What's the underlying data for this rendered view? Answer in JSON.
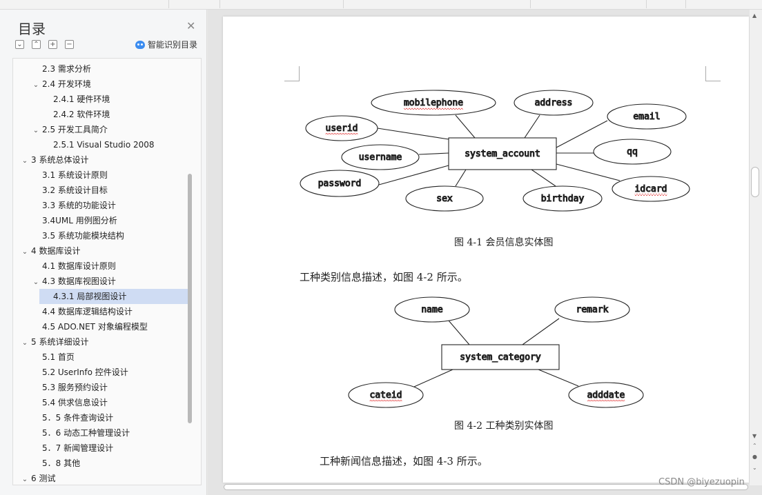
{
  "toc": {
    "title": "目录",
    "smart_label": "智能识别目录",
    "items": [
      {
        "label": "2.3  需求分析",
        "level": 1,
        "expand": ""
      },
      {
        "label": "2.4  开发环境",
        "level": 1,
        "expand": "open"
      },
      {
        "label": "2.4.1 硬件环境",
        "level": 2,
        "expand": ""
      },
      {
        "label": "2.4.2 软件环境",
        "level": 2,
        "expand": ""
      },
      {
        "label": "2.5 开发工具简介",
        "level": 1,
        "expand": "open"
      },
      {
        "label": "2.5.1 Visual Studio 2008",
        "level": 2,
        "expand": ""
      },
      {
        "label": "3 系统总体设计",
        "level": 0,
        "expand": "open"
      },
      {
        "label": "3.1 系统设计原则",
        "level": 1,
        "expand": ""
      },
      {
        "label": "3.2 系统设计目标",
        "level": 1,
        "expand": ""
      },
      {
        "label": "3.3 系统的功能设计",
        "level": 1,
        "expand": ""
      },
      {
        "label": "3.4UML 用例图分析",
        "level": 1,
        "expand": ""
      },
      {
        "label": "3.5 系统功能模块结构",
        "level": 1,
        "expand": ""
      },
      {
        "label": "4 数据库设计",
        "level": 0,
        "expand": "open"
      },
      {
        "label": "4.1 数据库设计原则",
        "level": 1,
        "expand": ""
      },
      {
        "label": "4.3 数据库视图设计",
        "level": 1,
        "expand": "open"
      },
      {
        "label": "4.3.1 局部视图设计",
        "level": 2,
        "expand": "",
        "selected": true
      },
      {
        "label": "4.4 数据库逻辑结构设计",
        "level": 1,
        "expand": ""
      },
      {
        "label": "4.5 ADO.NET  对象编程模型",
        "level": 1,
        "expand": ""
      },
      {
        "label": "5 系统详细设计",
        "level": 0,
        "expand": "open"
      },
      {
        "label": "5.1 首页",
        "level": 1,
        "expand": ""
      },
      {
        "label": "5.2 UserInfo 控件设计",
        "level": 1,
        "expand": ""
      },
      {
        "label": "5.3  服务预约设计",
        "level": 1,
        "expand": ""
      },
      {
        "label": "5.4 供求信息设计",
        "level": 1,
        "expand": ""
      },
      {
        "label": "5．5 条件查询设计",
        "level": 1,
        "expand": ""
      },
      {
        "label": "5．6 动态工种管理设计",
        "level": 1,
        "expand": ""
      },
      {
        "label": "5．7 新闻管理设计",
        "level": 1,
        "expand": ""
      },
      {
        "label": "5．8  其他",
        "level": 1,
        "expand": ""
      },
      {
        "label": "6 测试",
        "level": 0,
        "expand": "open"
      }
    ]
  },
  "document": {
    "diagram1": {
      "entity": "system_account",
      "attributes": [
        "mobilephone",
        "address",
        "email",
        "userid",
        "qq",
        "username",
        "password",
        "idcard",
        "sex",
        "birthday"
      ]
    },
    "caption1": "图 4-1  会员信息实体图",
    "para1": "工种类别信息描述，如图 4-2 所示。",
    "diagram2": {
      "entity": "system_category",
      "attributes": [
        "name",
        "remark",
        "cateid",
        "adddate"
      ]
    },
    "caption2": "图 4-2  工种类别实体图",
    "para2": "工种新闻信息描述，如图 4-3 所示。"
  },
  "watermark": "CSDN @biyezuopin",
  "colors": {
    "selected_row": "#cfdcf3",
    "ai_icon": "#3b8cf0",
    "spell_underline": "#e03030"
  }
}
